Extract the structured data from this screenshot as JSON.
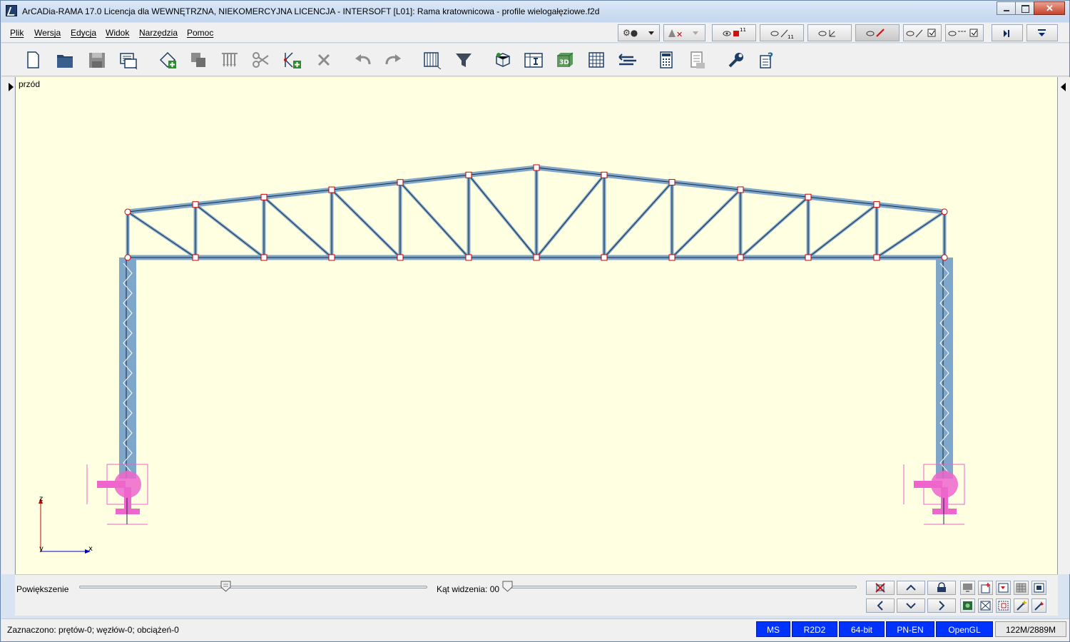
{
  "window": {
    "title": "ArCADia-RAMA 17.0 Licencja dla WEWNĘTRZNA, NIEKOMERCYJNA LICENCJA - INTERSOFT [L01]: Rama kratownicowa - profile wielogałęziowe.f2d"
  },
  "menu": {
    "items": [
      {
        "label": "Plik"
      },
      {
        "label": "Wersja"
      },
      {
        "label": "Edycja"
      },
      {
        "label": "Widok"
      },
      {
        "label": "Narzędzia"
      },
      {
        "label": "Pomoc"
      }
    ]
  },
  "view_toolbar": {
    "node_count_badge": "11",
    "bar_count_badge": "11"
  },
  "toolbar": {
    "icons": [
      "new-file-icon",
      "open-folder-icon",
      "save-icon",
      "export-icon",
      "add-node-icon",
      "copy-icon",
      "loads-icon",
      "cut-icon",
      "add-bar-icon",
      "delete-icon",
      "undo-icon",
      "redo-icon",
      "grid-icon",
      "filter-icon",
      "structure-3d-icon",
      "section-icon",
      "view-3d-icon",
      "table-icon",
      "align-icon",
      "calculator-icon",
      "report-icon",
      "settings-wrench-icon",
      "help-icon"
    ],
    "view3d_text": "3D"
  },
  "canvas": {
    "view_label": "przód",
    "axis_z": "z",
    "axis_y": "y",
    "axis_x": "x"
  },
  "zoombar": {
    "zoom_label": "Powiększenie",
    "zoom_level": 0.42,
    "angle_label": "Kąt widzenia: 00",
    "angle_level": 0.0
  },
  "status": {
    "selection": "Zaznaczono: prętów-0; węzłów-0; obciążeń-0",
    "badges": [
      "MS",
      "R2D2",
      "64-bit",
      "PN-EN",
      "OpenGL"
    ],
    "memory": "122M/2889M"
  },
  "colors": {
    "canvas_bg": "#ffffe1",
    "member": "#7fa7c9",
    "member_line": "#1a2a44",
    "node_marker": "#cc0000",
    "support": "#ee66cc",
    "badge": "#0033ff"
  }
}
